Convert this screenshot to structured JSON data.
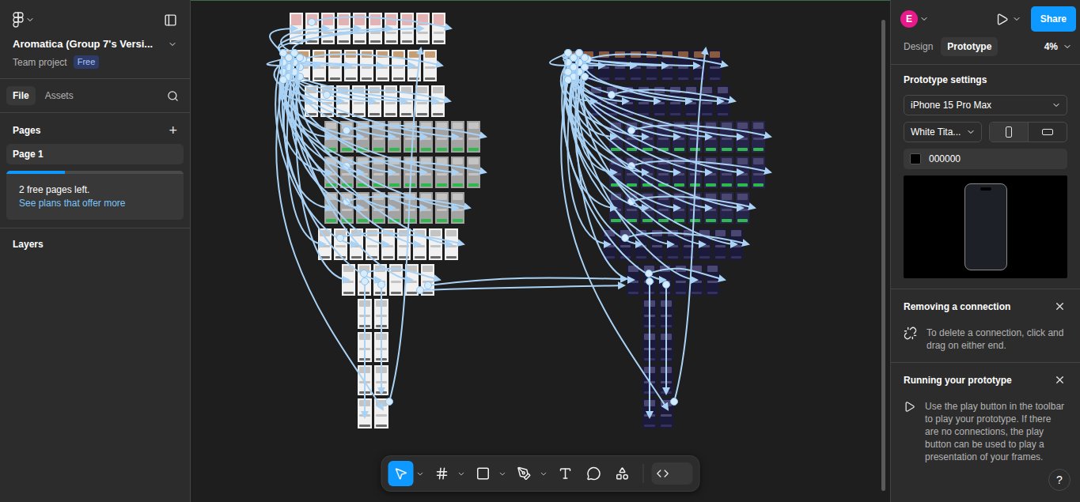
{
  "file": {
    "title": "Aromatica (Group 7's Versi...",
    "subtitle": "Team project",
    "badge": "Free"
  },
  "left_tabs": [
    {
      "label": "File",
      "selected": true
    },
    {
      "label": "Assets",
      "selected": false
    }
  ],
  "pages": {
    "heading": "Pages",
    "add": "+",
    "items": [
      {
        "label": "Page 1",
        "selected": true
      }
    ]
  },
  "plan_notice": {
    "level": 0.33,
    "text": "2 free pages left.",
    "link": "See plans that offer more"
  },
  "layers": {
    "heading": "Layers"
  },
  "canvas": {
    "clusters": [
      {
        "theme": "light"
      },
      {
        "theme": "dark"
      }
    ]
  },
  "toolbar": {
    "tools": [
      {
        "kind": "move",
        "menu": true,
        "selected": true
      },
      {
        "kind": "frame",
        "menu": true,
        "selected": false
      },
      {
        "kind": "shape",
        "menu": true,
        "selected": false
      },
      {
        "kind": "pen",
        "menu": true,
        "selected": false
      },
      {
        "kind": "text",
        "menu": false,
        "selected": false
      },
      {
        "kind": "comment",
        "menu": false,
        "selected": false
      },
      {
        "kind": "actions",
        "menu": false,
        "selected": false
      }
    ],
    "dev_mode_on": false
  },
  "header": {
    "avatar": "E",
    "share": "Share"
  },
  "right_tabs": [
    {
      "label": "Design",
      "selected": false
    },
    {
      "label": "Prototype",
      "selected": true
    }
  ],
  "zoom": "4%",
  "prototype_settings": {
    "heading": "Prototype settings",
    "device": "iPhone 15 Pro Max",
    "model": "White Tita...",
    "orientations": [
      {
        "kind": "portrait",
        "selected": true
      },
      {
        "kind": "landscape",
        "selected": false
      }
    ],
    "background": "000000"
  },
  "hints": [
    {
      "kind": "disconnect",
      "title": "Removing a connection",
      "body": "To delete a connection, click and drag on either end."
    },
    {
      "kind": "play",
      "title": "Running your prototype",
      "body": "Use the play button in the toolbar to play your prototype. If there are no connections, the play button can be used to play a presentation of your frames."
    }
  ],
  "help": "?"
}
